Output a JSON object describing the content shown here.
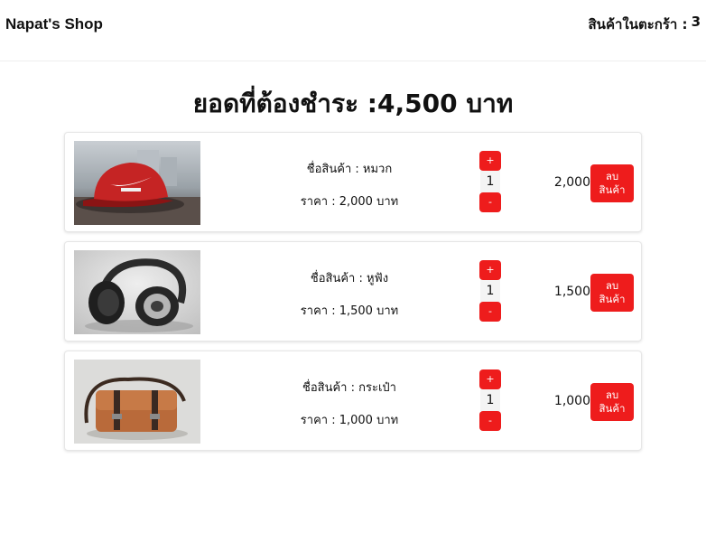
{
  "header": {
    "brand": "Napat's Shop",
    "cart_label": "สินค้าในตะกร้า :",
    "cart_count": "3"
  },
  "summary": {
    "total_label": "ยอดที่ต้องชำระ :4,500 บาท"
  },
  "buttons": {
    "plus": "+",
    "minus": "-",
    "remove": "ลบสินค้า"
  },
  "colors": {
    "accent": "#ee1c1c"
  },
  "items": [
    {
      "image": "red-cap-image",
      "name": "ชื่อสินค้า : หมวก",
      "price": "ราคา : 2,000 บาท",
      "qty": "1",
      "subtotal": "2,000"
    },
    {
      "image": "headphones-image",
      "name": "ชื่อสินค้า : หูฟัง",
      "price": "ราคา : 1,500 บาท",
      "qty": "1",
      "subtotal": "1,500"
    },
    {
      "image": "leather-bag-image",
      "name": "ชื่อสินค้า : กระเป๋า",
      "price": "ราคา : 1,000 บาท",
      "qty": "1",
      "subtotal": "1,000"
    }
  ]
}
